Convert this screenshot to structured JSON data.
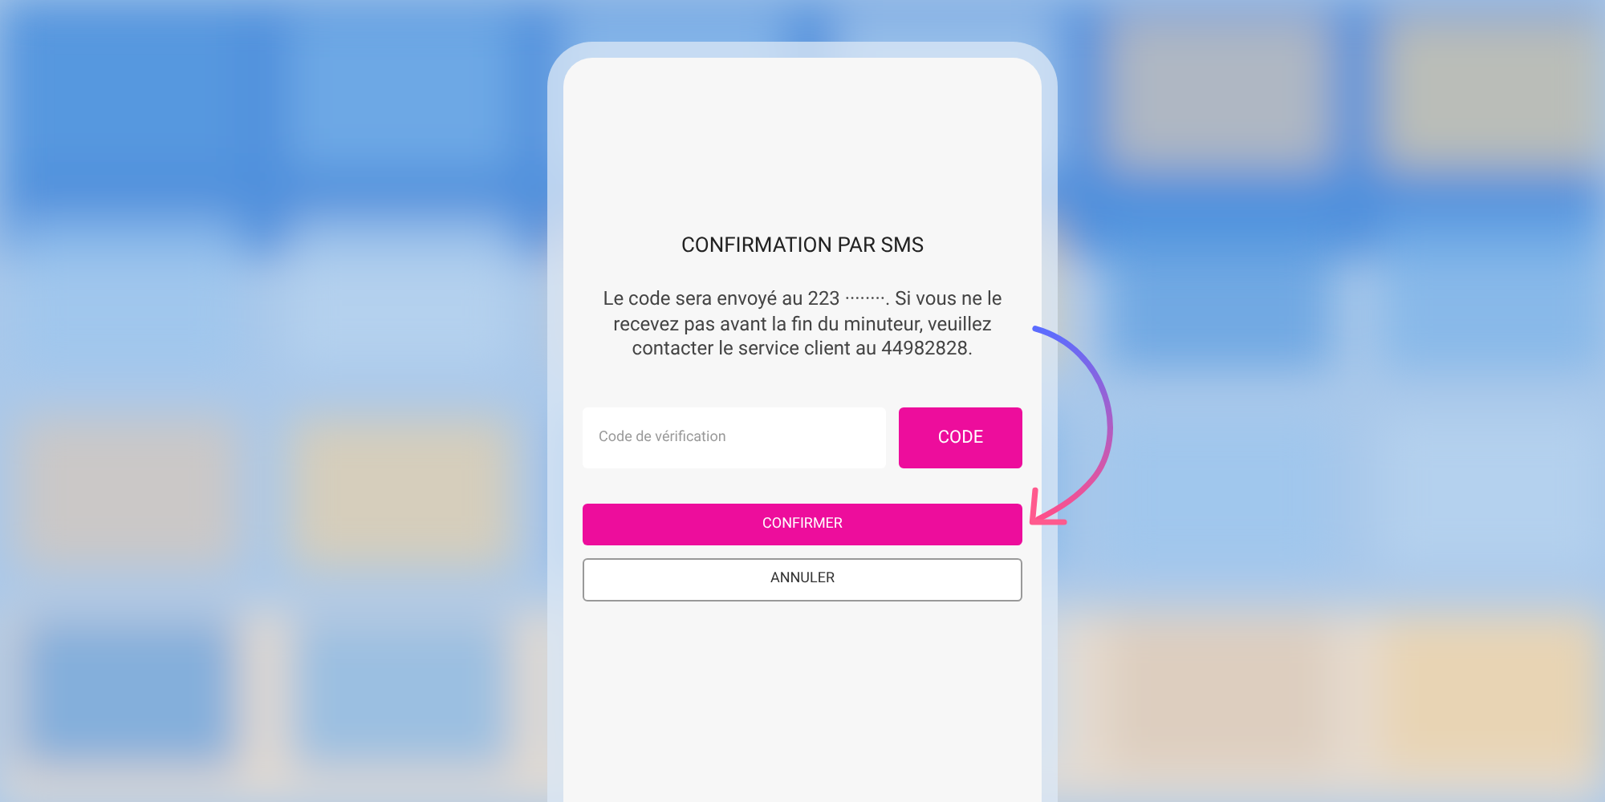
{
  "dialog": {
    "title": "CONFIRMATION PAR SMS",
    "message": "Le code sera envoyé au 223 ········. Si vous ne le recevez pas avant la fin du minuteur, veuillez contacter le service client au 44982828.",
    "code_field": {
      "placeholder": "Code de vérification"
    },
    "code_button": "CODE",
    "confirm_button": "CONFIRMER",
    "cancel_button": "ANNULER"
  }
}
